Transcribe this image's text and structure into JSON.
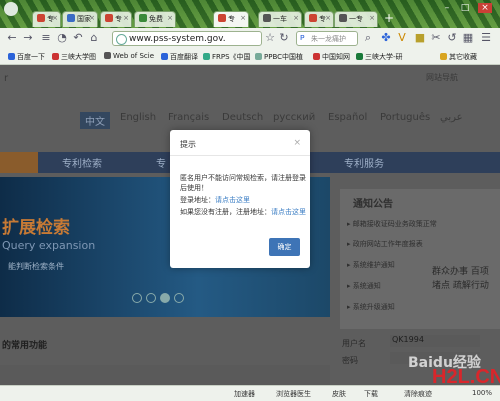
{
  "browser": {
    "tabs": [
      {
        "label": "专"
      },
      {
        "label": "国家"
      },
      {
        "label": "专"
      },
      {
        "label": "免费"
      },
      {
        "label": "专"
      },
      {
        "label": "一车"
      },
      {
        "label": "专"
      },
      {
        "label": "一专"
      }
    ],
    "url": "www.pss-system.gov.",
    "search_placeholder": "朱一龙痛护",
    "bookmarks": [
      {
        "label": "百度一下",
        "color": "#2b63d9"
      },
      {
        "label": "三峡大学图",
        "color": "#c33"
      },
      {
        "label": "Web of Scie",
        "color": "#555"
      },
      {
        "label": "百度翻译",
        "color": "#2b63d9"
      },
      {
        "label": "FRPS《中国",
        "color": "#3a8"
      },
      {
        "label": "PPBC中国植",
        "color": "#7a9"
      },
      {
        "label": "中国知网",
        "color": "#c33"
      },
      {
        "label": "三峡大学-研",
        "color": "#1a7a3a"
      },
      {
        "label": "其它收藏",
        "color": "#d9a520"
      }
    ]
  },
  "page": {
    "top_right_link": "网站导航",
    "languages": [
      "中文",
      "English",
      "Français",
      "Deutsch",
      "русский",
      "Español",
      "Português",
      "عربي"
    ],
    "nav": [
      "专利检索",
      "专",
      "专利服务"
    ],
    "hero_title": "扩展检索",
    "hero_sub": "Query expansion",
    "hero_desc": "能判断检索条件",
    "notice_title": "通知公告",
    "notices": [
      "邮箱接收证码业务政策正常",
      "政府网站工作年度报表",
      "系统维护通知",
      "系统通知",
      "系统升级通知"
    ],
    "common_functions": "的常用功能",
    "user_label": "用户名",
    "user_value": "QK1994",
    "password_label": "密码",
    "watermark_ad": "群众办事 百项堵点 疏解行动"
  },
  "dialog": {
    "title": "提示",
    "close": "×",
    "message": "匿名用户不能访问常规检索，请注册登录后使用！",
    "login_label": "登录地址：",
    "login_link": "请点击这里",
    "register_label": "如果您没有注册，注册地址：",
    "register_link": "请点击这里",
    "ok": "确定"
  },
  "statusbar": {
    "items": [
      "加速器",
      "浏览器医生",
      "皮肤",
      "下载",
      "清除痕迹",
      "100%"
    ]
  },
  "watermarks": {
    "baidu": "Baidu经验",
    "h2l": "H2L.CN"
  }
}
